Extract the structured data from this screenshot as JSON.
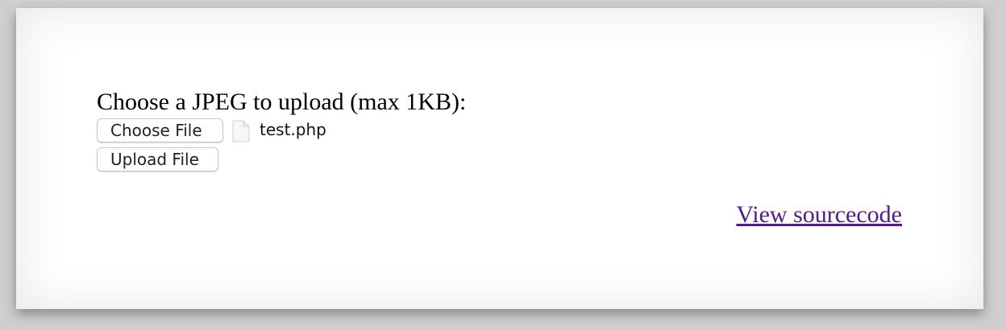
{
  "upload_form": {
    "prompt": "Choose a JPEG to upload (max 1KB):",
    "choose_file_label": "Choose File",
    "selected_file_name": "test.php",
    "file_icon": "document-icon",
    "upload_button_label": "Upload File"
  },
  "links": {
    "view_sourcecode": "View sourcecode"
  },
  "colors": {
    "visited_link": "#551a8b",
    "panel_background": "#ffffff",
    "page_background": "#cfcfcf"
  }
}
